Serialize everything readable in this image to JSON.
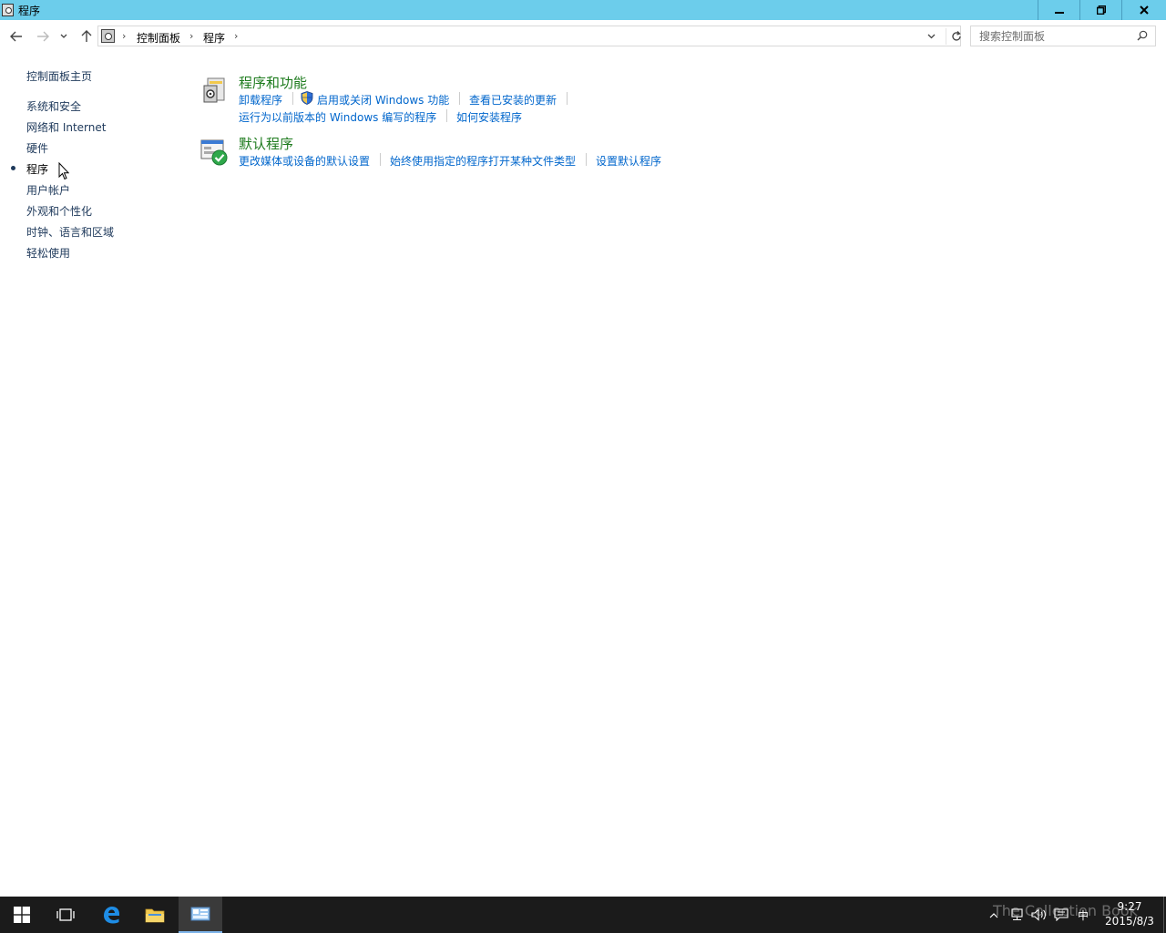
{
  "window": {
    "title": "程序",
    "controls": {
      "minimize": "🗕",
      "maximize": "🗗",
      "close": "✕"
    }
  },
  "navigation": {
    "back_icon": "arrow-left-icon",
    "forward_icon": "arrow-right-icon",
    "recent_icon": "chevron-down-icon",
    "up_icon": "arrow-up-icon"
  },
  "address_bar": {
    "breadcrumbs": [
      "控制面板",
      "程序"
    ]
  },
  "search": {
    "placeholder": "搜索控制面板"
  },
  "left_nav": {
    "home": "控制面板主页",
    "items": [
      {
        "label": "系统和安全"
      },
      {
        "label": "网络和 Internet"
      },
      {
        "label": "硬件"
      },
      {
        "label": "程序",
        "current": true
      },
      {
        "label": "用户帐户"
      },
      {
        "label": "外观和个性化"
      },
      {
        "label": "时钟、语言和区域"
      },
      {
        "label": "轻松使用"
      }
    ]
  },
  "categories": [
    {
      "title": "程序和功能",
      "icon": "programs-features-icon",
      "tasks": [
        "卸载程序",
        "启用或关闭 Windows 功能",
        "查看已安装的更新",
        "运行为以前版本的 Windows 编写的程序",
        "如何安装程序"
      ]
    },
    {
      "title": "默认程序",
      "icon": "default-programs-icon",
      "tasks": [
        "更改媒体或设备的默认设置",
        "始终使用指定的程序打开某种文件类型",
        "设置默认程序"
      ]
    }
  ],
  "taskbar": {
    "clock_time": "9:27",
    "clock_date": "2015/8/3",
    "ime": "中",
    "watermark": "The Collection Book"
  },
  "colors": {
    "titlebar": "#6ccdeb",
    "link": "#0066cc",
    "category_title": "#1e7b1e",
    "nav_text": "#1e395b",
    "taskbar": "#1b1b1b"
  }
}
